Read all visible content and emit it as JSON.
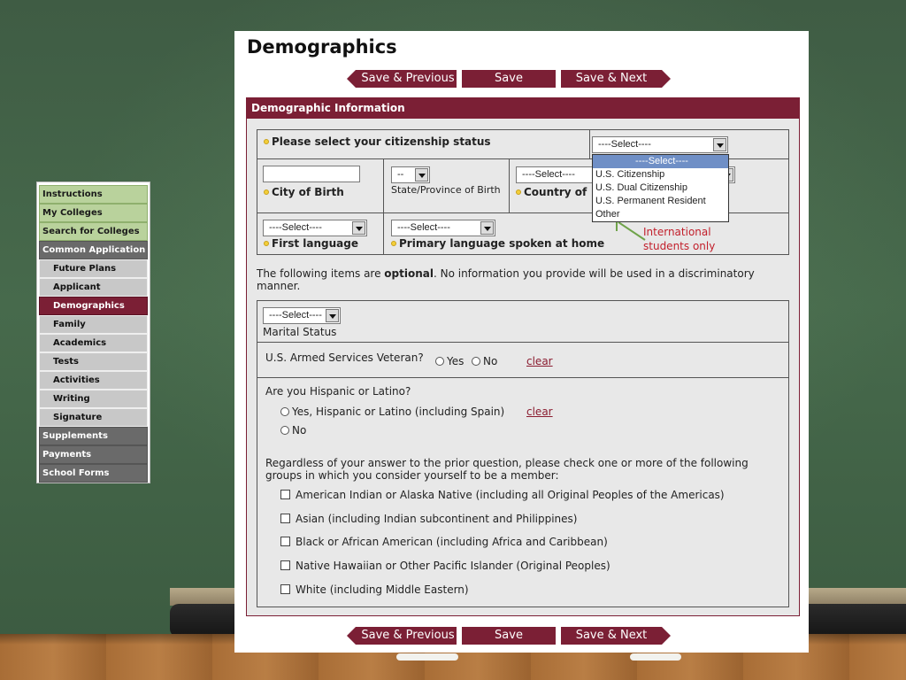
{
  "nav": {
    "items": [
      {
        "label": "Instructions",
        "style": "green"
      },
      {
        "label": "My Colleges",
        "style": "green"
      },
      {
        "label": "Search for Colleges",
        "style": "green"
      },
      {
        "label": "Common Application",
        "style": "dark"
      },
      {
        "label": "Future Plans",
        "style": "sub"
      },
      {
        "label": "Applicant",
        "style": "sub"
      },
      {
        "label": "Demographics",
        "style": "active"
      },
      {
        "label": "Family",
        "style": "sub"
      },
      {
        "label": "Academics",
        "style": "sub"
      },
      {
        "label": "Tests",
        "style": "sub"
      },
      {
        "label": "Activities",
        "style": "sub"
      },
      {
        "label": "Writing",
        "style": "sub"
      },
      {
        "label": "Signature",
        "style": "sub"
      },
      {
        "label": "Supplements",
        "style": "dark"
      },
      {
        "label": "Payments",
        "style": "dark"
      },
      {
        "label": "School Forms",
        "style": "dark"
      }
    ]
  },
  "page": {
    "title": "Demographics"
  },
  "buttons": {
    "prev": "Save & Previous",
    "save": "Save",
    "next": "Save & Next"
  },
  "section": {
    "title": "Demographic Information"
  },
  "citizenship": {
    "label": "Please select your citizenship status",
    "value": "----Select----",
    "options": [
      "----Select----",
      "U.S. Citizenship",
      "U.S. Dual Citizenship",
      "U.S. Permanent Resident",
      "Other"
    ]
  },
  "birth": {
    "city_label": "City of Birth",
    "city_value": "",
    "state_value": "--",
    "state_label": "State/Province of Birth",
    "country_value": "----Select----",
    "country_label": "Country of"
  },
  "language": {
    "first_value": "----Select----",
    "first_label": "First language",
    "home_value": "----Select----",
    "home_label": "Primary language spoken at home"
  },
  "annotation": {
    "line1": "International",
    "line2": "students only"
  },
  "optional": {
    "pre": "The following items are ",
    "bold": "optional",
    "post": ". No information you provide will be used in a discriminatory manner."
  },
  "marital": {
    "value": "----Select----",
    "label": "Marital Status"
  },
  "veteran": {
    "question": "U.S. Armed Services Veteran?",
    "yes": "Yes",
    "no": "No",
    "clear": "clear"
  },
  "hispanic": {
    "question": "Are you Hispanic or Latino?",
    "yes": "Yes, Hispanic or Latino (including Spain)",
    "no": "No",
    "clear": "clear"
  },
  "race": {
    "intro": "Regardless of your answer to the prior question, please check one or more of the following groups in which you consider yourself to be a member:",
    "options": [
      "American Indian or Alaska Native (including all Original Peoples of the Americas)",
      "Asian (including Indian subcontinent and Philippines)",
      "Black or African American (including Africa and Caribbean)",
      "Native Hawaiian or Other Pacific Islander (Original Peoples)",
      "White (including Middle Eastern)"
    ]
  },
  "colors": {
    "accent": "#7b1f35",
    "nav_green": "#b9d29c",
    "nav_dark": "#6a6a6a",
    "annotation": "#c21f2b"
  }
}
